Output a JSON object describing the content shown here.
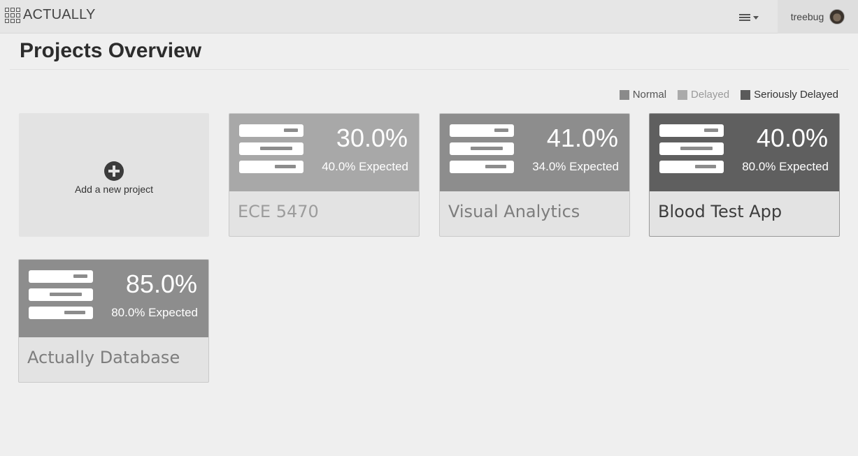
{
  "header": {
    "brand": "ACTUALLY",
    "brand_icon": "grid-icon",
    "menu_icon": "menu-icon",
    "username": "treebug"
  },
  "page": {
    "title": "Projects Overview"
  },
  "legend": [
    {
      "label": "Normal",
      "color": "#8a8a8a",
      "text_color": "#555555"
    },
    {
      "label": "Delayed",
      "color": "#aaaaaa",
      "text_color": "#9a9a9a"
    },
    {
      "label": "Seriously Delayed",
      "color": "#5a5a5a",
      "text_color": "#333333"
    }
  ],
  "add_project": {
    "label": "Add a new project",
    "icon": "plus-circle-icon"
  },
  "projects": [
    {
      "name": "ECE 5470",
      "percent": "30.0%",
      "expected": "40.0% Expected",
      "status": "Delayed",
      "color": "#a8a8a8",
      "name_color": "#9c9c9c"
    },
    {
      "name": "Visual Analytics",
      "percent": "41.0%",
      "expected": "34.0% Expected",
      "status": "Normal",
      "color": "#8d8d8d",
      "name_color": "#7d7d7d"
    },
    {
      "name": "Blood Test App",
      "percent": "40.0%",
      "expected": "80.0% Expected",
      "status": "Seriously Delayed",
      "color": "#5f5f5f",
      "name_color": "#3d3d3d"
    },
    {
      "name": "Actually Database",
      "percent": "85.0%",
      "expected": "80.0% Expected",
      "status": "Normal",
      "color": "#8d8d8d",
      "name_color": "#7d7d7d"
    }
  ]
}
